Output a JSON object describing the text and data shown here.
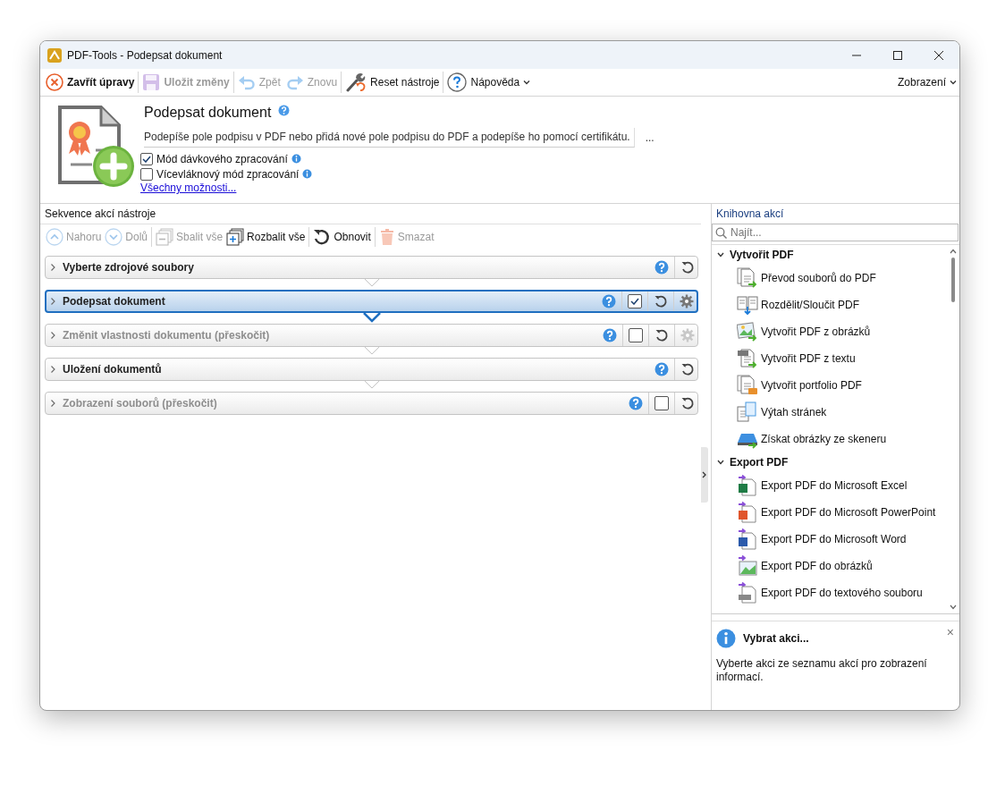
{
  "window": {
    "title": "PDF-Tools - Podepsat dokument"
  },
  "toolbar": {
    "buttons": [
      {
        "label": "Zavřít úpravy",
        "kind": "close",
        "disabled": false,
        "bold": true
      },
      {
        "label": "Uložit změny",
        "kind": "save",
        "disabled": true,
        "bold": true
      },
      {
        "label": "Zpět",
        "kind": "undo",
        "disabled": true,
        "bold": false
      },
      {
        "label": "Znovu",
        "kind": "redo",
        "disabled": true,
        "bold": false
      },
      {
        "label": "Reset nástroje",
        "kind": "wrench",
        "disabled": false,
        "bold": false
      },
      {
        "label": "Nápověda",
        "kind": "help",
        "disabled": false,
        "bold": false,
        "dropdown": true
      }
    ],
    "view_menu": {
      "label": "Zobrazení",
      "dropdown": true
    }
  },
  "header": {
    "title": "Podepsat dokument",
    "description": "Podepíše pole podpisu v PDF nebo přidá nové pole podpisu do PDF a podepíše ho pomocí certifikátu.",
    "more": "...",
    "options": [
      {
        "label": "Mód dávkového zpracování",
        "checked": true
      },
      {
        "label": "Vícevláknový mód zpracování",
        "checked": false
      }
    ],
    "link": "Všechny možnosti..."
  },
  "sequence": {
    "title": "Sekvence akcí nástroje",
    "buttons": [
      {
        "label": "Nahoru",
        "kind": "up",
        "disabled": true
      },
      {
        "label": "Dolů",
        "kind": "down",
        "disabled": true
      },
      {
        "label": "Sbalit vše",
        "kind": "collapse",
        "disabled": true
      },
      {
        "label": "Rozbalit vše",
        "kind": "expand",
        "disabled": false
      },
      {
        "label": "Obnovit",
        "kind": "refresh",
        "disabled": false
      },
      {
        "label": "Smazat",
        "kind": "delete",
        "disabled": true
      }
    ],
    "steps": [
      {
        "label": "Vyberte zdrojové soubory",
        "selected": false,
        "skipped": false
      },
      {
        "label": "Podepsat dokument",
        "selected": true,
        "skipped": false,
        "checked": true,
        "gear_enabled": true
      },
      {
        "label": "Změnit vlastnosti dokumentu (přeskočit)",
        "selected": false,
        "skipped": true,
        "checked": false,
        "gear_enabled": false
      },
      {
        "label": "Uložení dokumentů",
        "selected": false,
        "skipped": false
      },
      {
        "label": "Zobrazení souborů (přeskočit)",
        "selected": false,
        "skipped": true,
        "checked": false
      }
    ]
  },
  "library": {
    "title": "Knihovna akcí",
    "search": {
      "placeholder": "Najít..."
    },
    "groups": [
      {
        "label": "Vytvořit PDF",
        "expanded": true,
        "items": [
          {
            "label": "Převod souborů do PDF",
            "kind": "convert"
          },
          {
            "label": "Rozdělit/Sloučit PDF",
            "kind": "split"
          },
          {
            "label": "Vytvořit PDF z obrázků",
            "kind": "images"
          },
          {
            "label": "Vytvořit PDF z textu",
            "kind": "text"
          },
          {
            "label": "Vytvořit portfolio PDF",
            "kind": "portfolio"
          },
          {
            "label": "Výtah stránek",
            "kind": "extract"
          },
          {
            "label": "Získat obrázky ze skeneru",
            "kind": "scanner"
          }
        ]
      },
      {
        "label": "Export PDF",
        "expanded": true,
        "items": [
          {
            "label": "Export PDF do Microsoft Excel",
            "kind": "excel"
          },
          {
            "label": "Export PDF do Microsoft PowerPoint",
            "kind": "powerpoint"
          },
          {
            "label": "Export PDF do Microsoft Word",
            "kind": "word"
          },
          {
            "label": "Export PDF do obrázků",
            "kind": "export-images"
          },
          {
            "label": "Export PDF do textového souboru",
            "kind": "export-text"
          }
        ]
      }
    ]
  },
  "info": {
    "title": "Vybrat akci...",
    "text": "Vyberte akci ze seznamu akcí pro zobrazení informací.",
    "close": "×"
  }
}
